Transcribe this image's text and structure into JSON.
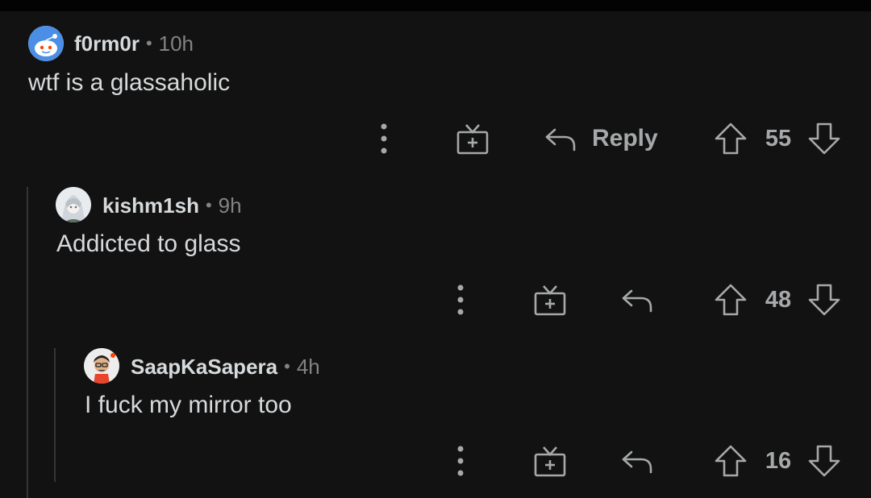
{
  "comments": [
    {
      "username": "f0rm0r",
      "separator": "•",
      "time": "10h",
      "body": "wtf is a glassaholic",
      "score": "55",
      "reply_label": "Reply",
      "avatar_icon": "snoo-avatar-icon"
    },
    {
      "username": "kishm1sh",
      "separator": "•",
      "time": "9h",
      "body": "Addicted to glass",
      "score": "48",
      "avatar_icon": "anime-avatar-icon"
    },
    {
      "username": "SaapKaSapera",
      "separator": "•",
      "time": "4h",
      "body": "I fuck my mirror too",
      "score": "16",
      "avatar_icon": "character-avatar-icon"
    }
  ],
  "colors": {
    "background": "#121212",
    "text": "#d7dadc",
    "muted": "#818384",
    "icon": "#a6a8aa",
    "thread_line": "#343536"
  }
}
